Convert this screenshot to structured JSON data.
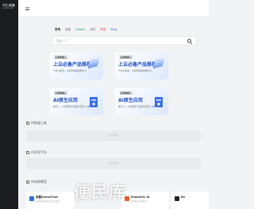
{
  "sidebar": {
    "logo_text": "AI工具集",
    "logo_sub": "ai-tool.site"
  },
  "search": {
    "tabs": [
      "常用",
      "百度",
      "Google",
      "站内",
      "淘宝",
      "Bing"
    ],
    "placeholder": "百度一下"
  },
  "banners": [
    {
      "badge": "百度智能云",
      "title": "上云必备产品推荐",
      "subtitle": "千帆大模型，立即体验精选推荐卡"
    },
    {
      "badge": "百度智能云",
      "title": "上云必备产品推荐",
      "subtitle": "千帆大模型，立即体验精选推荐卡"
    },
    {
      "badge": "百度智能云",
      "title": "AI原生应用",
      "subtitle": "数字人、AI客服等产品限时低至1.9折"
    },
    {
      "badge": "百度智能云",
      "title": "AI原生应用",
      "subtitle": "数字人、AI客服等产品限时低至1.9折"
    }
  ],
  "sections": {
    "s1_label": "AI绘画工具",
    "s2_label": "AI开发平台",
    "s3_label": "AI训练模型",
    "empty_text": "没有内容"
  },
  "cards": [
    {
      "name": "商量SenseChat",
      "desc": "商汤科技推出的大语言模型…",
      "color": "#2f6fdb"
    },
    {
      "name": "Embodily AI",
      "desc": "中国科技公司开发…",
      "color": "#e85d2a"
    },
    {
      "name": "Bo",
      "desc": "…",
      "color": "#222222"
    }
  ],
  "watermark": "便民库"
}
